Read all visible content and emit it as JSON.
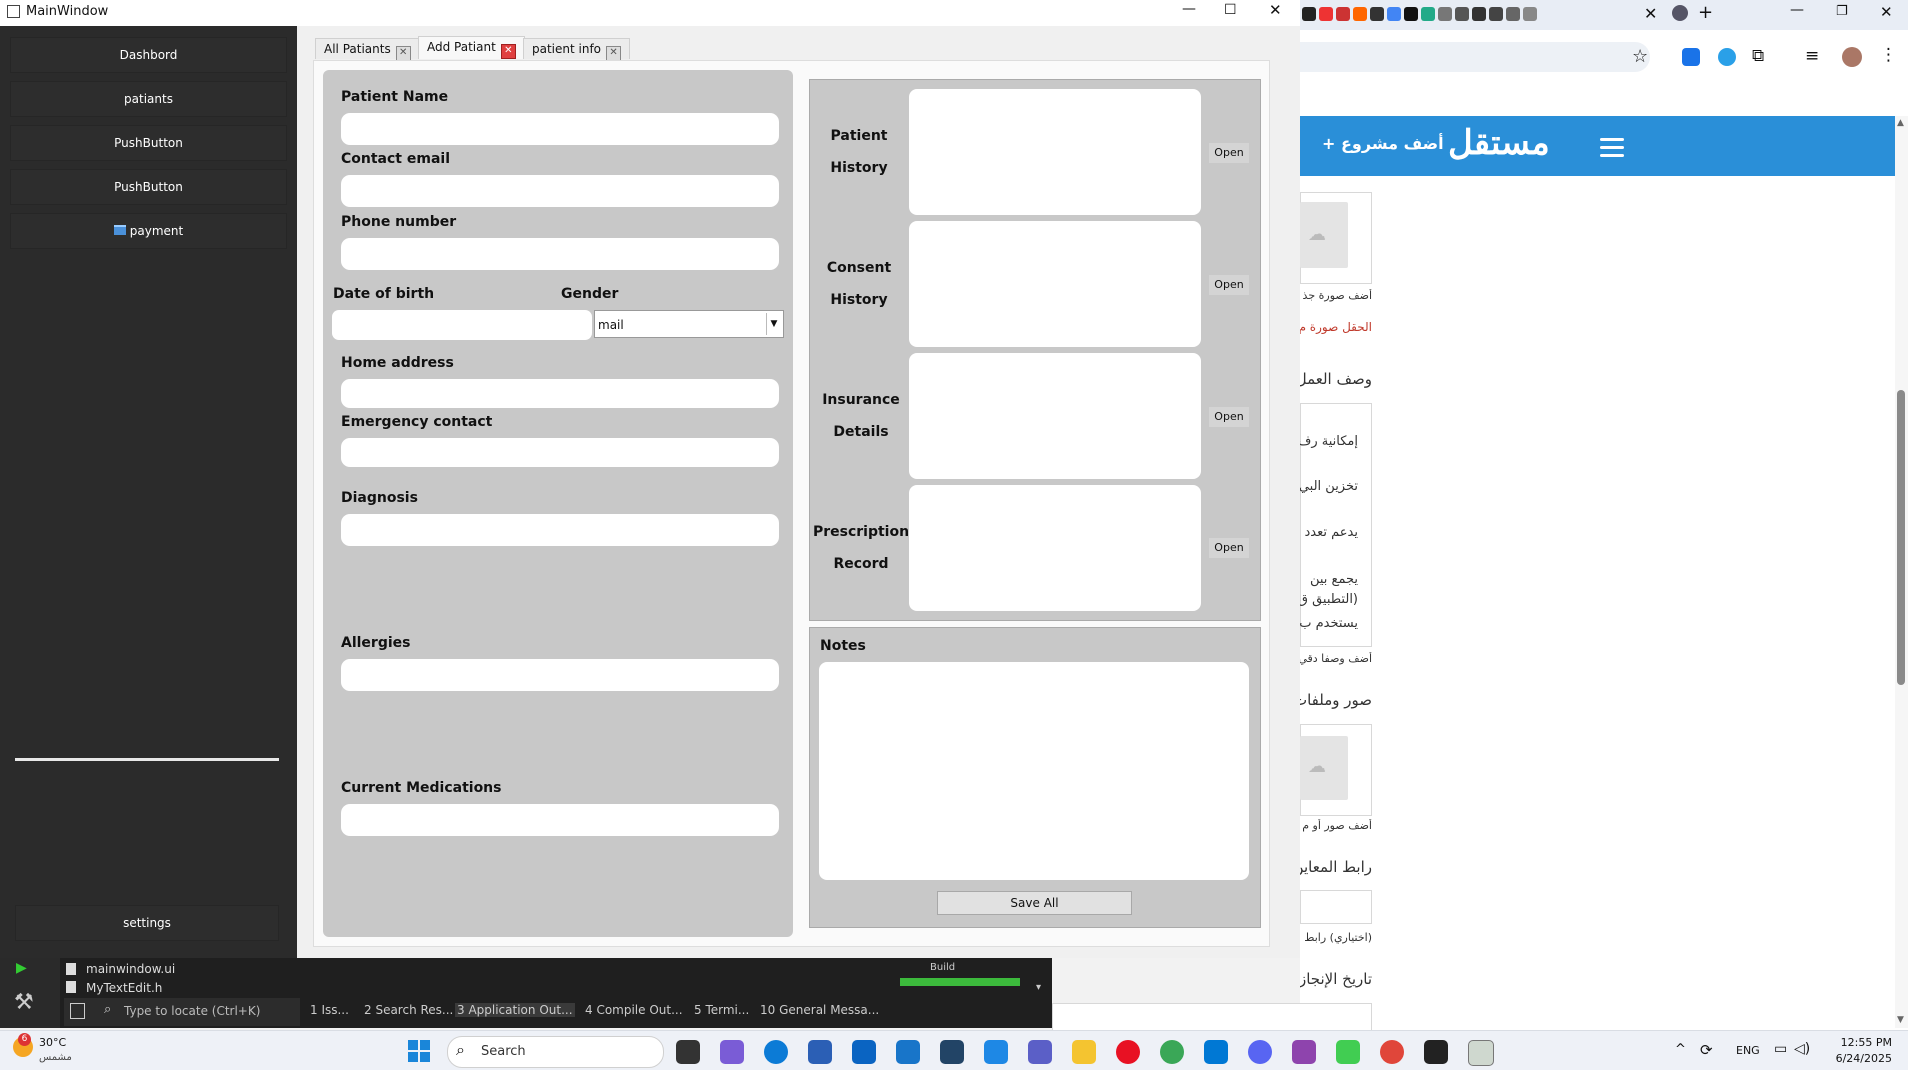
{
  "window": {
    "title": "MainWindow",
    "controls": {
      "minimize": "—",
      "maximize": "☐",
      "close": "✕"
    }
  },
  "sidebar": {
    "items": [
      {
        "label": "Dashbord"
      },
      {
        "label": "patiants"
      },
      {
        "label": "PushButton"
      },
      {
        "label": "PushButton"
      },
      {
        "label": "payment",
        "icon": "card-icon"
      }
    ],
    "settings_label": "settings"
  },
  "tabs": [
    {
      "label": "All Patiants",
      "active": false
    },
    {
      "label": "Add Patiant",
      "active": true
    },
    {
      "label": "patient info",
      "active": false
    }
  ],
  "form": {
    "patient_name": "Patient Name",
    "contact_email": "Contact email",
    "phone_number": "Phone number",
    "date_of_birth": "Date of birth",
    "gender": "Gender",
    "gender_value": "mail",
    "home_address": "Home address",
    "emergency_contact": "Emergency contact",
    "diagnosis": "Diagnosis",
    "allergies": "Allergies",
    "current_medications": "Current Medications"
  },
  "documents": [
    {
      "line1": "Patient",
      "line2": "History",
      "button": "Open"
    },
    {
      "line1": "Consent",
      "line2": "History",
      "button": "Open"
    },
    {
      "line1": "Insurance",
      "line2": "Details",
      "button": "Open"
    },
    {
      "line1": "Prescription",
      "line2": "Record",
      "button": "Open"
    }
  ],
  "notes": {
    "label": "Notes",
    "save_label": "Save All"
  },
  "ide": {
    "files": [
      "mainwindow.ui",
      "MyTextEdit.h"
    ],
    "locate_placeholder": "Type to locate (Ctrl+K)",
    "build_label": "Build",
    "panes": [
      "1  Iss...",
      "2  Search Res...",
      "3  Application Out...",
      "4  Compile Out...",
      "5  Termi...",
      "10  General Messa..."
    ]
  },
  "website": {
    "logo": "مستقل",
    "add_project": "+ أضف مشروع",
    "snippets": [
      "أضف صورة جذ",
      "الحقل صورة م",
      "وصف العمل",
      "إمكانية رف",
      "تخزين البي",
      "يدعم تعدد",
      "يجمع بين",
      "(التطبيق ق",
      "يستخدم ب",
      "أضف وصفا دقي",
      "صور وملفات",
      "أضف صور أو م",
      "رابط المعاين",
      "(اختياري) رابط",
      "تاريخ الإنجاز"
    ]
  },
  "taskbar": {
    "weather_temp": "30°C",
    "weather_desc": "مشمس",
    "weather_badge": "6",
    "search_label": "Search",
    "language": "ENG",
    "time": "12:55 PM",
    "date": "6/24/2025"
  },
  "colors": {
    "site_blue": "#2a8fd8",
    "sidebar": "#2b2b2b",
    "panel": "#c8c8c8"
  }
}
